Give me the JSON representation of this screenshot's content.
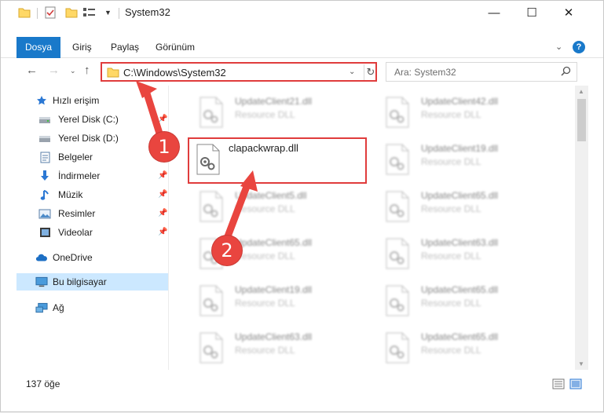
{
  "window": {
    "title": "System32",
    "controls": {
      "minimize": "—",
      "maximize": "☐",
      "close": "✕"
    }
  },
  "ribbon": {
    "tabs": [
      "Dosya",
      "Giriş",
      "Paylaş",
      "Görünüm"
    ],
    "help": "?"
  },
  "navigation": {
    "address": "C:\\Windows\\System32",
    "search_placeholder": "Ara: System32"
  },
  "sidebar": {
    "quick_access": "Hızlı erişim",
    "items": [
      {
        "label": "Yerel Disk (C:)",
        "icon": "drive-icon",
        "pinned": true
      },
      {
        "label": "Yerel Disk (D:)",
        "icon": "drive-icon",
        "pinned": false
      },
      {
        "label": "Belgeler",
        "icon": "documents-icon",
        "pinned": true
      },
      {
        "label": "İndirmeler",
        "icon": "downloads-icon",
        "pinned": true
      },
      {
        "label": "Müzik",
        "icon": "music-icon",
        "pinned": true
      },
      {
        "label": "Resimler",
        "icon": "pictures-icon",
        "pinned": true
      },
      {
        "label": "Videolar",
        "icon": "videos-icon",
        "pinned": true
      }
    ],
    "onedrive": "OneDrive",
    "this_pc": "Bu bilgisayar",
    "network": "Ağ"
  },
  "files": [
    {
      "name": "UpdateClient21.dll",
      "type": "Resource DLL"
    },
    {
      "name": "UpdateClient42.dll",
      "type": "Resource DLL"
    },
    {
      "name": "clapackwrap.dll",
      "type": ""
    },
    {
      "name": "UpdateClient19.dll",
      "type": "Resource DLL"
    },
    {
      "name": "UpdateClient5.dll",
      "type": "Resource DLL"
    },
    {
      "name": "UpdateClient65.dll",
      "type": "Resource DLL"
    },
    {
      "name": "UpdateClient65.dll",
      "type": "Resource DLL"
    },
    {
      "name": "UpdateClient63.dll",
      "type": "Resource DLL"
    },
    {
      "name": "UpdateClient19.dll",
      "type": "Resource DLL"
    },
    {
      "name": "UpdateClient65.dll",
      "type": "Resource DLL"
    },
    {
      "name": "UpdateClient63.dll",
      "type": "Resource DLL"
    },
    {
      "name": "UpdateClient65.dll",
      "type": "Resource DLL"
    }
  ],
  "status": {
    "item_count": "137 öğe"
  },
  "annotations": {
    "step1": "1",
    "step2": "2"
  },
  "colors": {
    "accent": "#1979ca",
    "annotation": "#e03c3c",
    "selection": "#cce8ff"
  }
}
